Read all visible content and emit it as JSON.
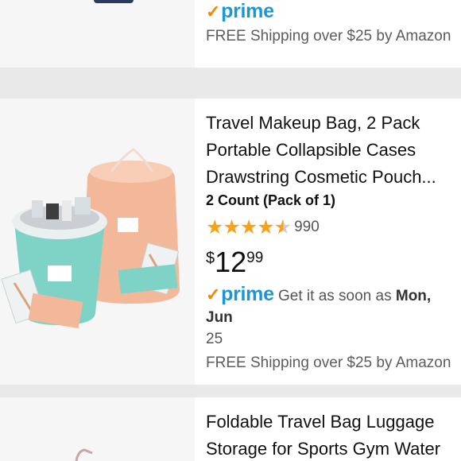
{
  "card_top": {
    "prime_label": "prime",
    "shipping": "FREE Shipping over $25 by Amazon"
  },
  "card_main": {
    "title_lines": [
      "Travel Makeup Bag, 2 Pack",
      "Portable Collapsible Cases",
      "Drawstring Cosmetic Pouch..."
    ],
    "count": "2 Count (Pack of 1)",
    "rating_stars": 4.5,
    "rating_count": "990",
    "price_currency": "$",
    "price_whole": "12",
    "price_fraction": "99",
    "prime_label": "prime",
    "delivery_prefix": "Get it as soon as",
    "delivery_date": "Mon, Jun",
    "delivery_cont": "25",
    "shipping": "FREE Shipping over $25 by Amazon"
  },
  "card_next": {
    "title_lines": [
      "Foldable Travel Bag Luggage",
      "Storage for Sports Gym Water"
    ]
  },
  "colors": {
    "prime_blue": "#1a98d5",
    "prime_check": "#f08804",
    "star": "#f7a21b",
    "bag_teal": "#7fd3c6",
    "bag_peach": "#f3b89a"
  }
}
